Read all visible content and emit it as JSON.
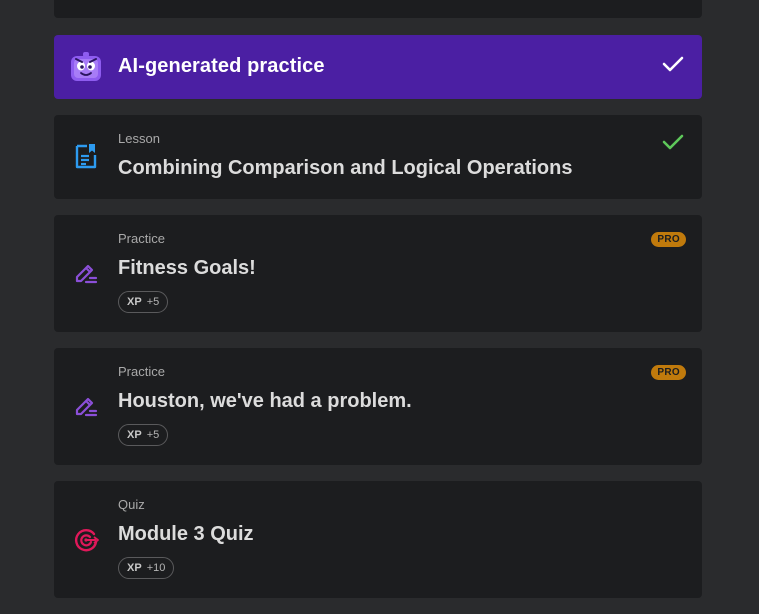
{
  "ai_section": {
    "title": "AI-generated practice",
    "completed": true
  },
  "items": [
    {
      "kind": "Lesson",
      "title": "Combining Comparison and Logical Operations",
      "completed": true,
      "icon": "lesson-document-icon"
    },
    {
      "kind": "Practice",
      "title": "Fitness Goals!",
      "badge": "PRO",
      "xp_label": "XP",
      "xp_value": "+5",
      "icon": "practice-pencil-icon"
    },
    {
      "kind": "Practice",
      "title": "Houston, we've had a problem.",
      "badge": "PRO",
      "xp_label": "XP",
      "xp_value": "+5",
      "icon": "practice-pencil-icon"
    },
    {
      "kind": "Quiz",
      "title": "Module 3 Quiz",
      "xp_label": "XP",
      "xp_value": "+10",
      "icon": "quiz-target-icon"
    }
  ],
  "colors": {
    "background": "#2a2b2d",
    "card": "#1c1d1f",
    "ai_banner": "#4b1fa3",
    "check_green": "#5ec85a",
    "pro_badge": "#c07a0c",
    "lesson_icon": "#2d9bf0",
    "practice_icon": "#8b4fd8",
    "quiz_icon": "#e0185a"
  }
}
